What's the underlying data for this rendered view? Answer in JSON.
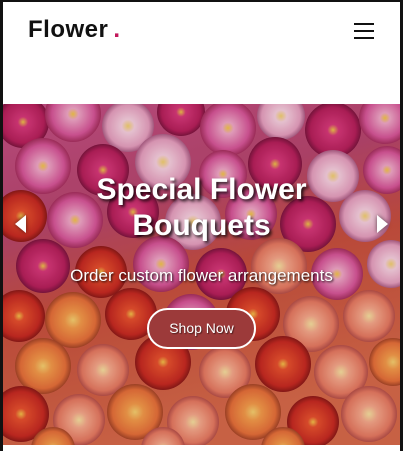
{
  "header": {
    "brand": "Flower",
    "brand_dot": ".",
    "menu_icon": "hamburger-menu-icon"
  },
  "hero": {
    "title": "Special Flower Bouquets",
    "subtitle": "Order custom flower arrangements",
    "cta_label": "Shop Now",
    "prev_icon": "chevron-left-icon",
    "next_icon": "chevron-right-icon",
    "background": "dahlia-flowers-photo"
  },
  "colors": {
    "brand_dot": "#c2185b",
    "cta_background": "#9c3a3a",
    "text": "#111111"
  }
}
